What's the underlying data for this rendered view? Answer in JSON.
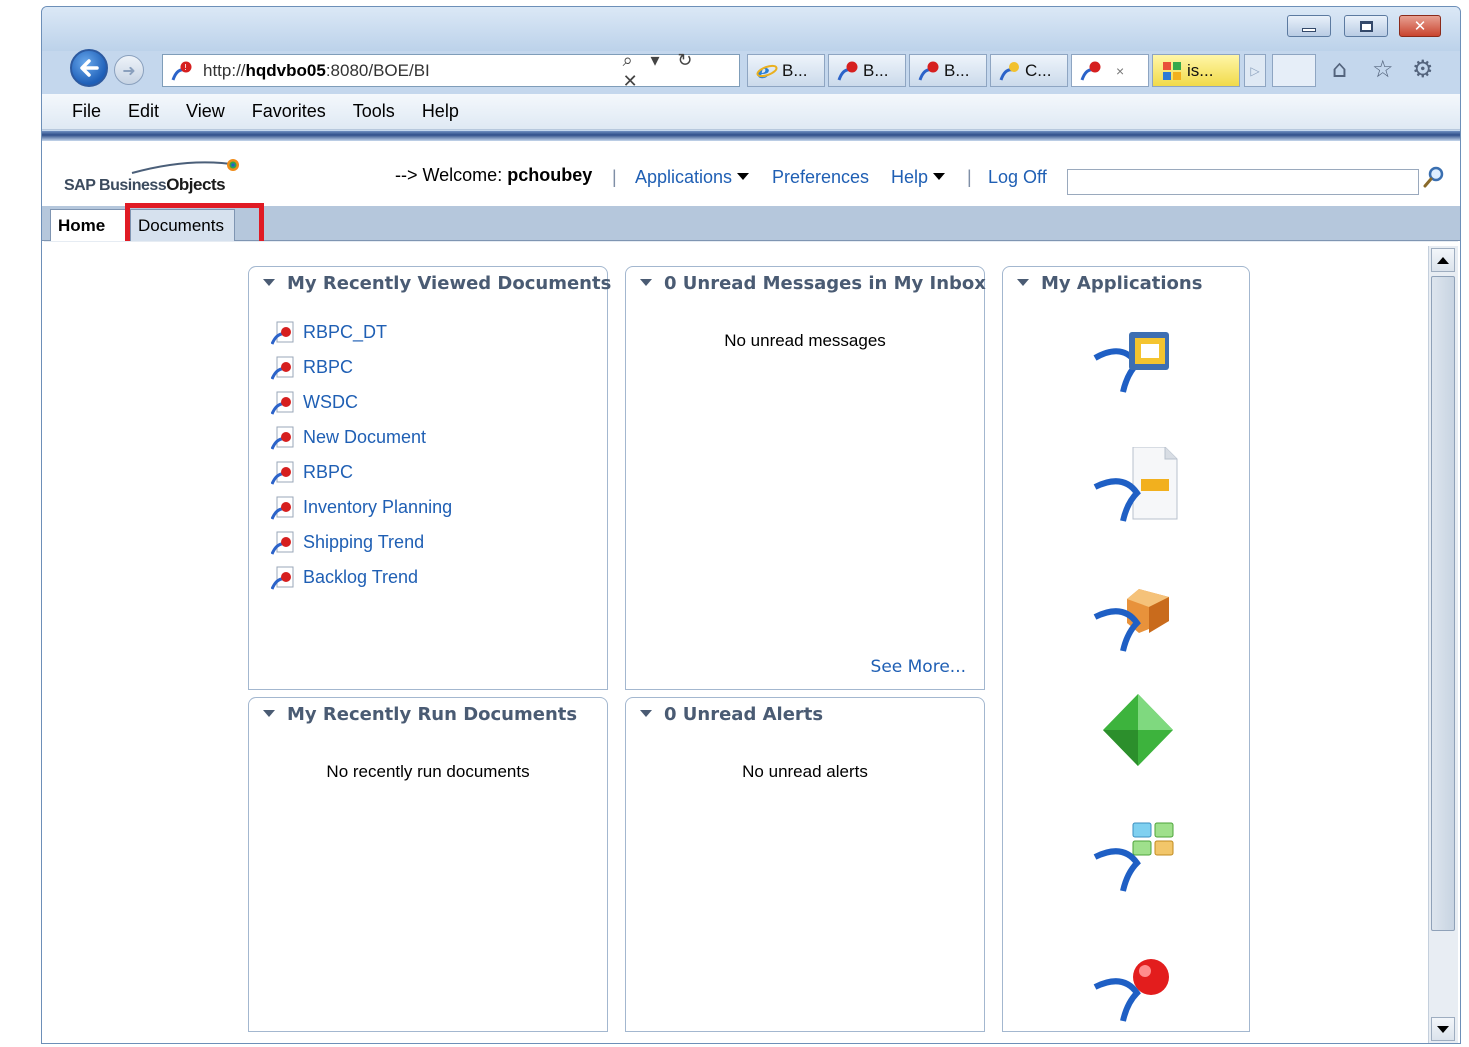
{
  "browser": {
    "address_host": "hqdvbo05",
    "address_rest": ":8080/BOE/BI",
    "address_prefix": "http://",
    "address_tools": "⌕ ▾ ↻ ✕",
    "tabs": [
      {
        "label": "B..."
      },
      {
        "label": "B..."
      },
      {
        "label": "B..."
      },
      {
        "label": "C..."
      },
      {
        "label": ""
      },
      {
        "label": "is..."
      }
    ],
    "tab_close_glyph": "×",
    "menu": [
      "File",
      "Edit",
      "View",
      "Favorites",
      "Tools",
      "Help"
    ]
  },
  "header": {
    "logo_sap": "SAP Business",
    "logo_objects": "Objects",
    "welcome_prefix": "--> Welcome: ",
    "username": "pchoubey",
    "links": {
      "applications": "Applications",
      "preferences": "Preferences",
      "help": "Help",
      "logoff": "Log Off"
    },
    "search_value": ""
  },
  "page_tabs": {
    "home": "Home",
    "documents": "Documents"
  },
  "portlets": {
    "recently_viewed": {
      "title": "My Recently Viewed Documents",
      "documents": [
        "RBPC_DT",
        "RBPC",
        "WSDC",
        "New Document",
        "RBPC",
        "Inventory Planning",
        "Shipping Trend",
        "Backlog Trend"
      ]
    },
    "inbox": {
      "title": "0 Unread Messages in My Inbox",
      "empty": "No unread messages",
      "see_more": "See More..."
    },
    "applications": {
      "title": "My Applications"
    },
    "recently_run": {
      "title": "My Recently Run Documents",
      "empty": "No recently run documents"
    },
    "alerts": {
      "title": "0 Unread Alerts",
      "empty": "No unread alerts"
    }
  },
  "colors": {
    "link": "#1f5fb4",
    "highlight": "#e01b24",
    "portlet_border": "#a3b7cf",
    "tab_strip": "#b5c7dc"
  }
}
